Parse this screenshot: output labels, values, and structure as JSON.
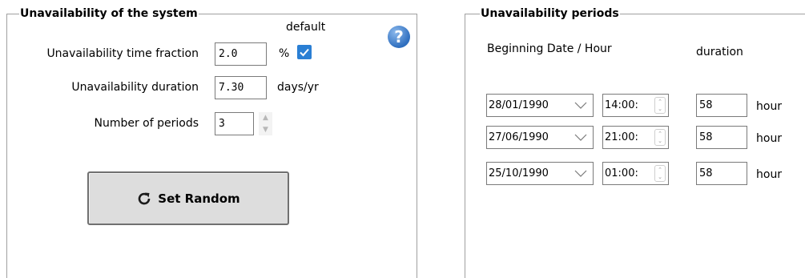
{
  "system_group": {
    "title": "Unavailability of the system",
    "default_label": "default",
    "fraction_label": "Unavailability time fraction",
    "fraction_value": "2.0",
    "fraction_unit": "%",
    "default_checked": true,
    "duration_label": "Unavailability duration",
    "duration_value": "7.30",
    "duration_unit": "days/yr",
    "periods_label": "Number of periods",
    "periods_value": "3",
    "random_button_label": "Set Random",
    "help_glyph": "?"
  },
  "periods_group": {
    "title": "Unavailability periods",
    "col_begin_label": "Beginning Date / Hour",
    "col_duration_label": "duration",
    "rows": [
      {
        "date": "28/01/1990",
        "time": "14:00:",
        "duration": "58",
        "unit": "hour"
      },
      {
        "date": "27/06/1990",
        "time": "21:00:",
        "duration": "58",
        "unit": "hour"
      },
      {
        "date": "25/10/1990",
        "time": "01:00:",
        "duration": "58",
        "unit": "hour"
      }
    ]
  },
  "colors": {
    "accent": "#2a7fd4",
    "frame": "#a0a0a0",
    "button_bg": "#dddddd"
  },
  "icons": {
    "help": "question-circle-icon",
    "refresh": "refresh-icon",
    "check": "checkmark-icon",
    "chevron": "chevron-down-icon"
  }
}
